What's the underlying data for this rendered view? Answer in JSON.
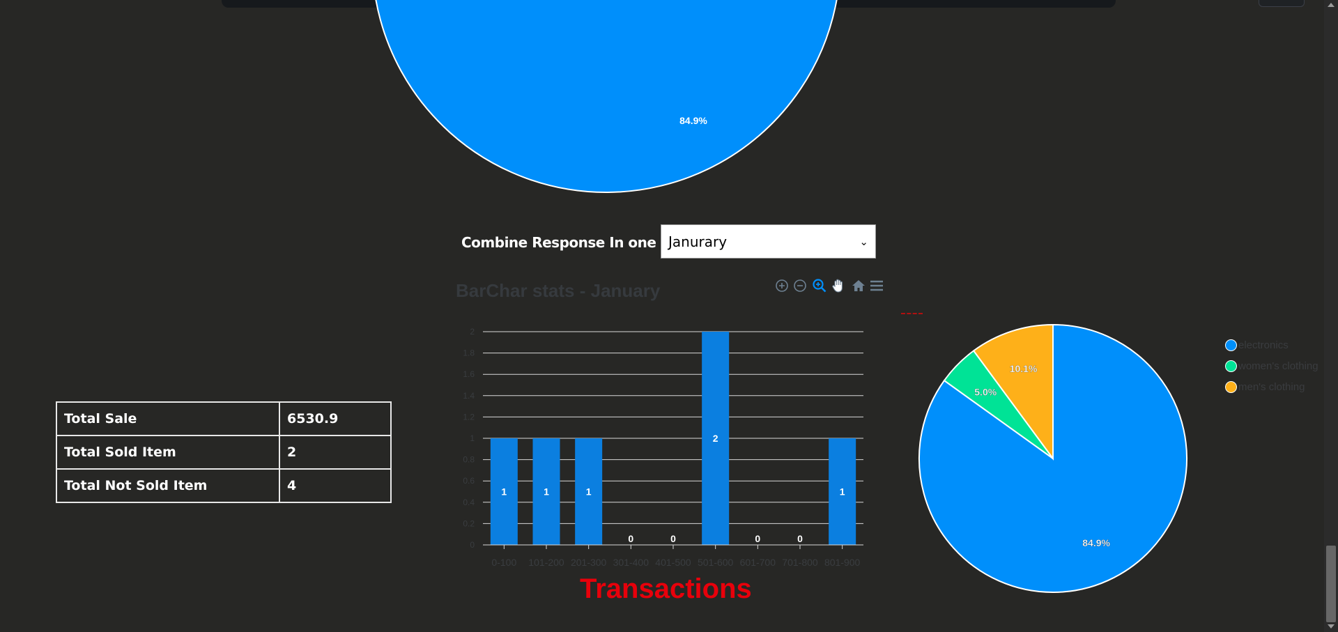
{
  "combine": {
    "label": "Combine Response In one",
    "selected": "Janurary"
  },
  "bar_chart_title": "BarChar stats - January",
  "toolbar": {
    "icons": [
      "zoom-in-icon",
      "zoom-out-icon",
      "selection-zoom-icon",
      "pan-hand-icon",
      "home-reset-icon",
      "menu-icon"
    ]
  },
  "summary": [
    {
      "label": "Total Sale",
      "value": "6530.9"
    },
    {
      "label": "Total Sold Item",
      "value": "2"
    },
    {
      "label": "Total Not Sold Item",
      "value": "4"
    }
  ],
  "footer_title": "Transactions",
  "colors": {
    "background": "#272725",
    "bar": "#0b7fe0",
    "electronics": "#008ffb",
    "womens": "#00e396",
    "mens": "#feb019",
    "title_red": "#e8000b"
  },
  "chart_data": [
    {
      "type": "pie",
      "title": "",
      "labels": [
        "electronics",
        "women's clothing",
        "men's clothing"
      ],
      "values": [
        84.9,
        5.0,
        10.1
      ],
      "data_labels": [
        "84.9%",
        "5.0%",
        "10.1%"
      ],
      "note_visible_label": "84.9%"
    },
    {
      "type": "bar",
      "title": "BarChar stats - January",
      "categories": [
        "0-100",
        "101-200",
        "201-300",
        "301-400",
        "401-500",
        "501-600",
        "601-700",
        "701-800",
        "801-900"
      ],
      "values": [
        1,
        1,
        1,
        0,
        0,
        2,
        0,
        0,
        1
      ],
      "ylim": [
        0,
        2
      ],
      "yticks": [
        "0",
        "0.2",
        "0.4",
        "0.6",
        "0.8",
        "1",
        "1.2",
        "1.4",
        "1.6",
        "1.8",
        "2"
      ],
      "grid": true
    },
    {
      "type": "pie",
      "title": "",
      "labels": [
        "electronics",
        "women's clothing",
        "men's clothing"
      ],
      "values": [
        84.9,
        5.0,
        10.1
      ],
      "data_labels": [
        "84.9%",
        "5.0%",
        "10.1%"
      ],
      "legend": "right"
    }
  ]
}
